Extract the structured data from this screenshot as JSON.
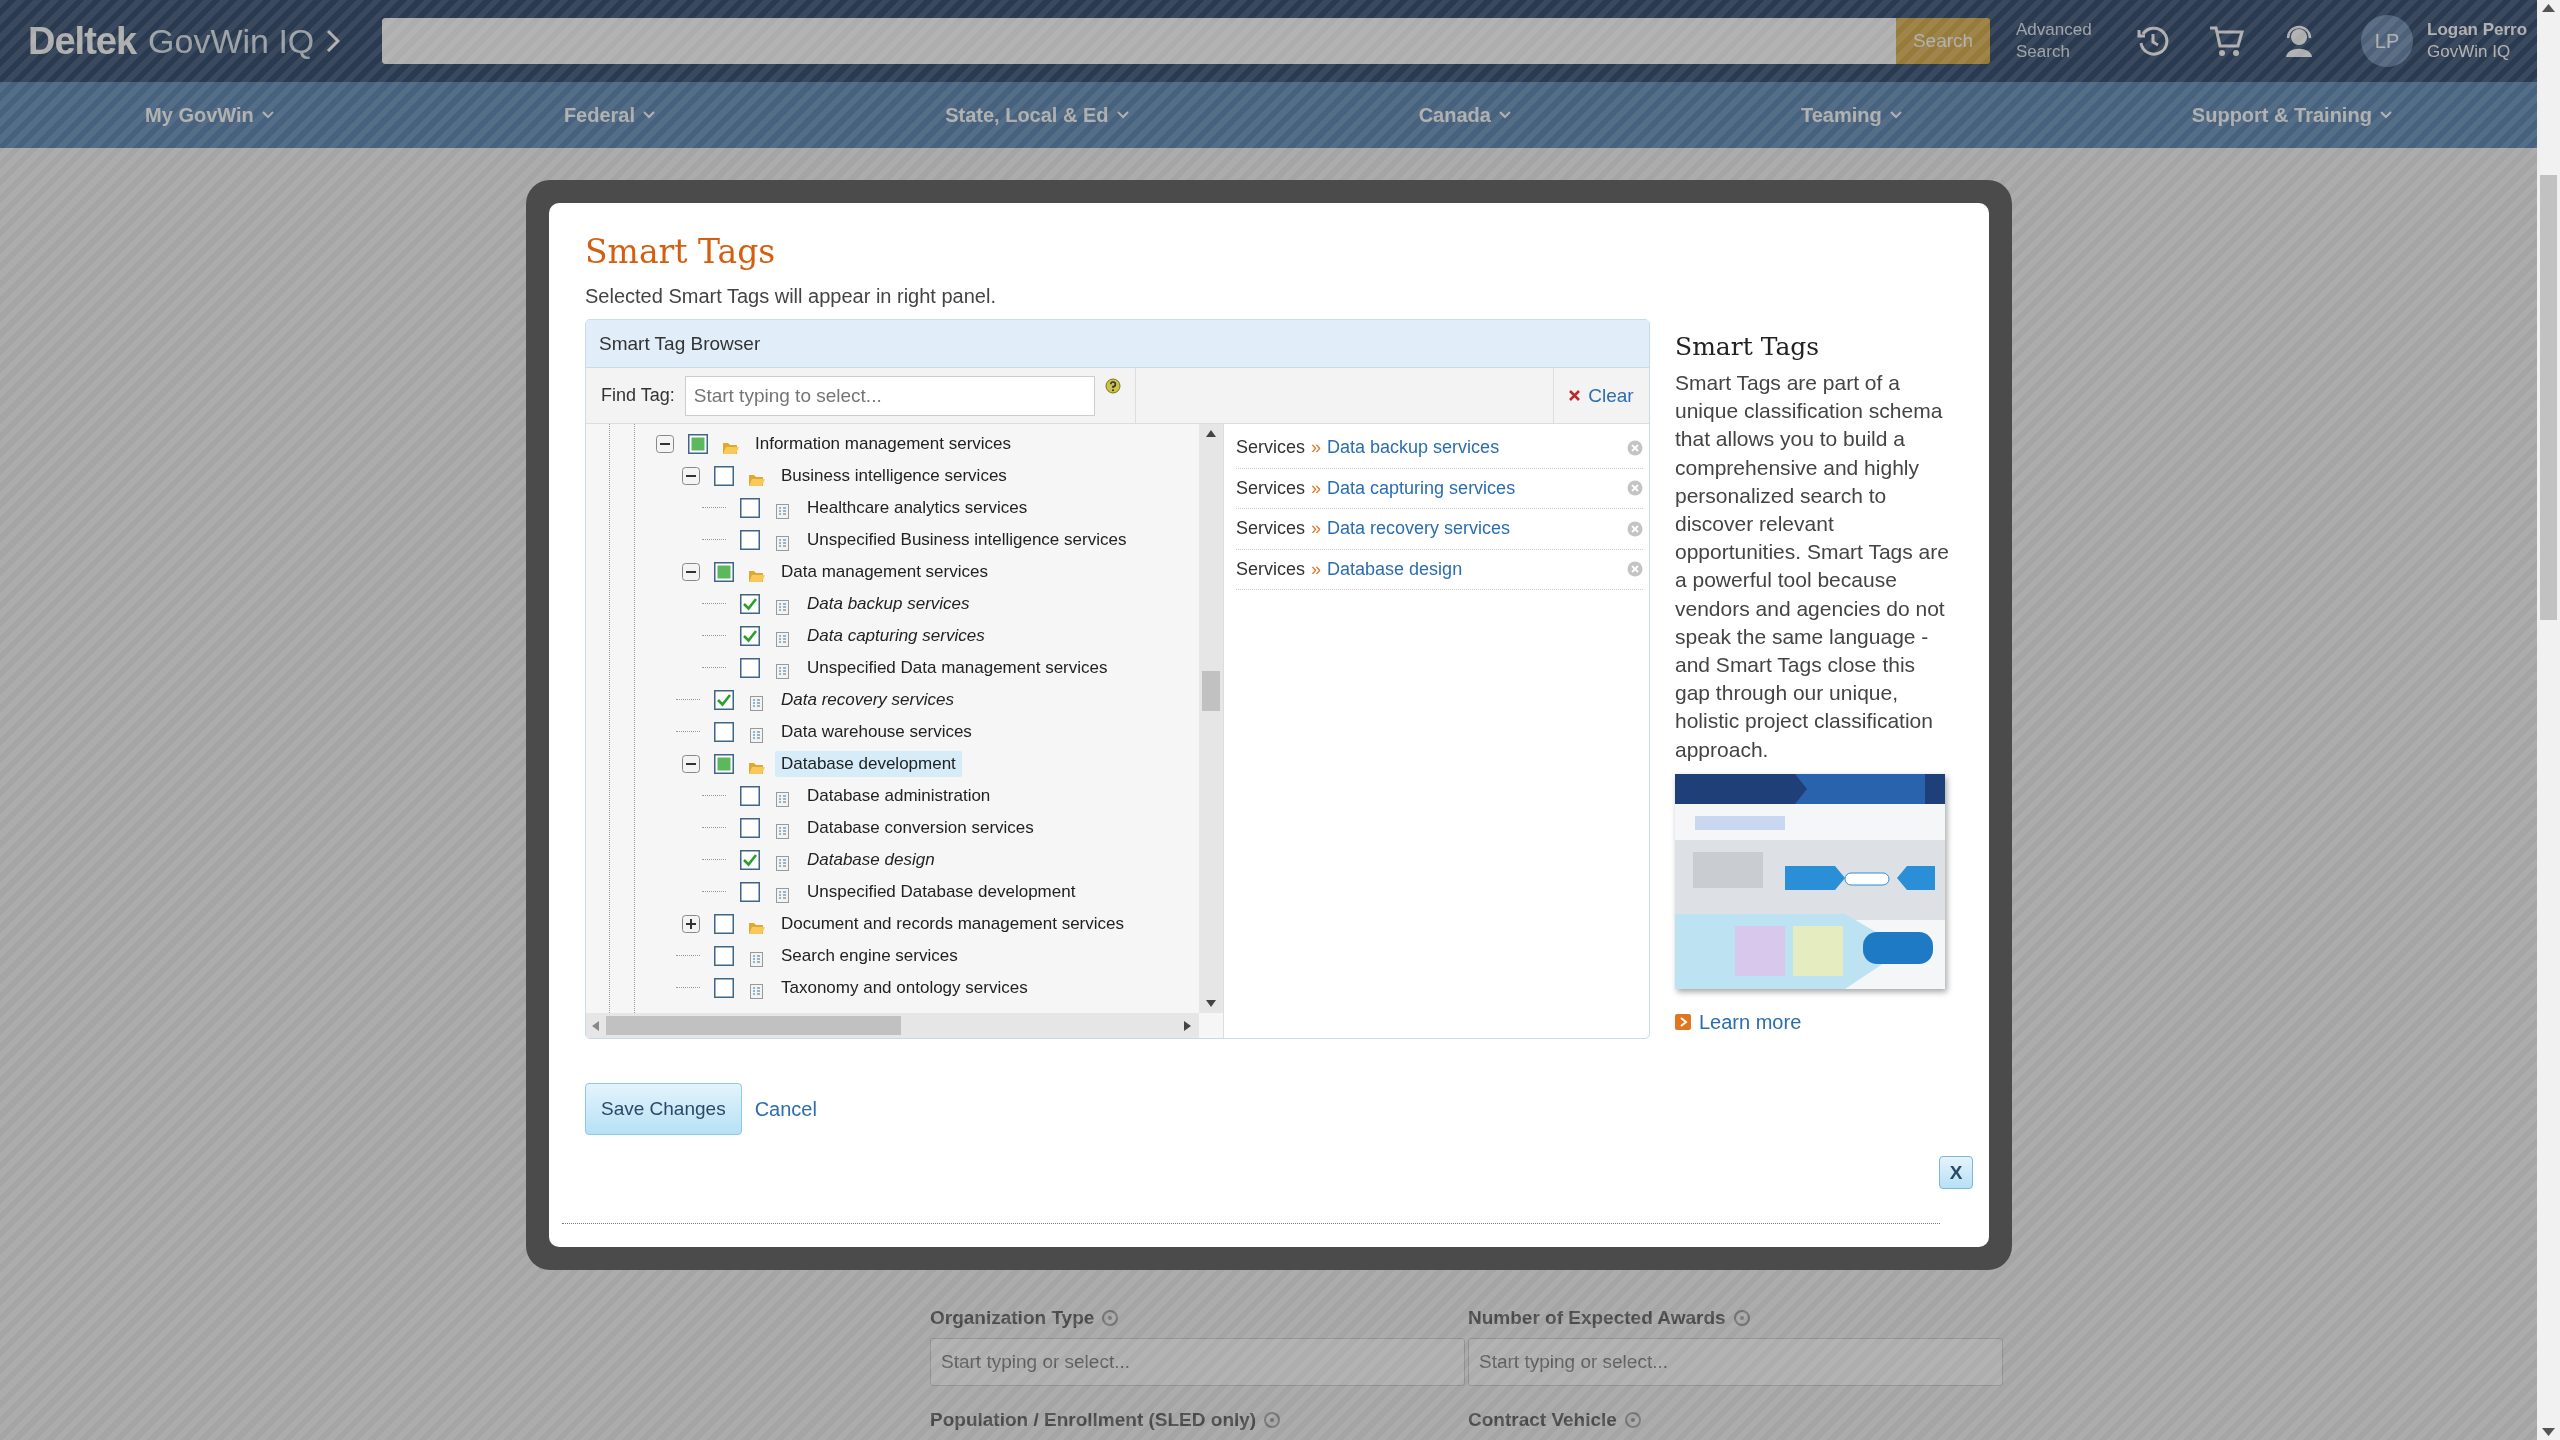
{
  "header": {
    "logo": "Deltek",
    "product": "GovWin IQ",
    "search_button": "Search",
    "advanced_search": "Advanced Search",
    "user_initials": "LP",
    "user_name": "Logan Perro",
    "user_org": "GovWin IQ"
  },
  "nav": [
    {
      "label": "My GovWin"
    },
    {
      "label": "Federal"
    },
    {
      "label": "State, Local & Ed"
    },
    {
      "label": "Canada"
    },
    {
      "label": "Teaming"
    },
    {
      "label": "Support & Training"
    }
  ],
  "modal": {
    "title": "Smart Tags",
    "subtitle": "Selected Smart Tags will appear in right panel.",
    "browser": {
      "title": "Smart Tag Browser",
      "find_label": "Find Tag:",
      "find_placeholder": "Start typing to select...",
      "clear": "Clear",
      "tree": [
        {
          "label": "Information management services",
          "kind": "folder",
          "checked": false,
          "partial": true,
          "expanded": true,
          "selected": false,
          "children": [
            {
              "label": "Business intelligence services",
              "kind": "folder",
              "checked": false,
              "partial": false,
              "expanded": true,
              "selected": false,
              "children": [
                {
                  "label": "Healthcare analytics services",
                  "kind": "leaf",
                  "checked": false,
                  "partial": false,
                  "selected": false
                },
                {
                  "label": "Unspecified Business intelligence services",
                  "kind": "leaf",
                  "checked": false,
                  "partial": false,
                  "selected": false
                }
              ]
            },
            {
              "label": "Data management services",
              "kind": "folder",
              "checked": false,
              "partial": true,
              "expanded": true,
              "selected": false,
              "children": [
                {
                  "label": "Data backup services",
                  "kind": "leaf",
                  "checked": true,
                  "partial": false,
                  "selected": false
                },
                {
                  "label": "Data capturing services",
                  "kind": "leaf",
                  "checked": true,
                  "partial": false,
                  "selected": false
                },
                {
                  "label": "Unspecified Data management services",
                  "kind": "leaf",
                  "checked": false,
                  "partial": false,
                  "selected": false
                }
              ]
            },
            {
              "label": "Data recovery services",
              "kind": "leaf",
              "checked": true,
              "partial": false,
              "selected": false
            },
            {
              "label": "Data warehouse services",
              "kind": "leaf",
              "checked": false,
              "partial": false,
              "selected": false
            },
            {
              "label": "Database development",
              "kind": "folder",
              "checked": false,
              "partial": true,
              "expanded": true,
              "selected": true,
              "children": [
                {
                  "label": "Database administration",
                  "kind": "leaf",
                  "checked": false,
                  "partial": false,
                  "selected": false
                },
                {
                  "label": "Database conversion services",
                  "kind": "leaf",
                  "checked": false,
                  "partial": false,
                  "selected": false
                },
                {
                  "label": "Database design",
                  "kind": "leaf",
                  "checked": true,
                  "partial": false,
                  "selected": false
                },
                {
                  "label": "Unspecified Database development",
                  "kind": "leaf",
                  "checked": false,
                  "partial": false,
                  "selected": false
                }
              ]
            },
            {
              "label": "Document and records management services",
              "kind": "folder",
              "checked": false,
              "partial": false,
              "expanded": false,
              "selected": false
            },
            {
              "label": "Search engine services",
              "kind": "leaf",
              "checked": false,
              "partial": false,
              "selected": false
            },
            {
              "label": "Taxonomy and ontology services",
              "kind": "leaf",
              "checked": false,
              "partial": false,
              "selected": false
            }
          ]
        }
      ],
      "selected_tags": [
        {
          "category": "Services",
          "separator": "»",
          "tag": "Data backup services"
        },
        {
          "category": "Services",
          "separator": "»",
          "tag": "Data capturing services"
        },
        {
          "category": "Services",
          "separator": "»",
          "tag": "Data recovery services"
        },
        {
          "category": "Services",
          "separator": "»",
          "tag": "Database design"
        }
      ]
    },
    "info": {
      "title": "Smart Tags",
      "body": "Smart Tags are part of a unique classification schema that allows you to build a comprehensive and highly personalized search to discover relevant opportunities. Smart Tags are a powerful tool because vendors and agencies do not speak the same language - and Smart Tags close this gap through our unique, holistic project classification approach.",
      "link": "Learn more"
    },
    "save": "Save Changes",
    "cancel": "Cancel",
    "close": "X"
  },
  "form": {
    "fields": [
      {
        "label": "Organization Type",
        "placeholder": "Start typing or select..."
      },
      {
        "label": "Number of Expected Awards",
        "placeholder": "Start typing or select..."
      },
      {
        "label": "Population / Enrollment (SLED only)"
      },
      {
        "label": "Contract Vehicle"
      }
    ]
  }
}
